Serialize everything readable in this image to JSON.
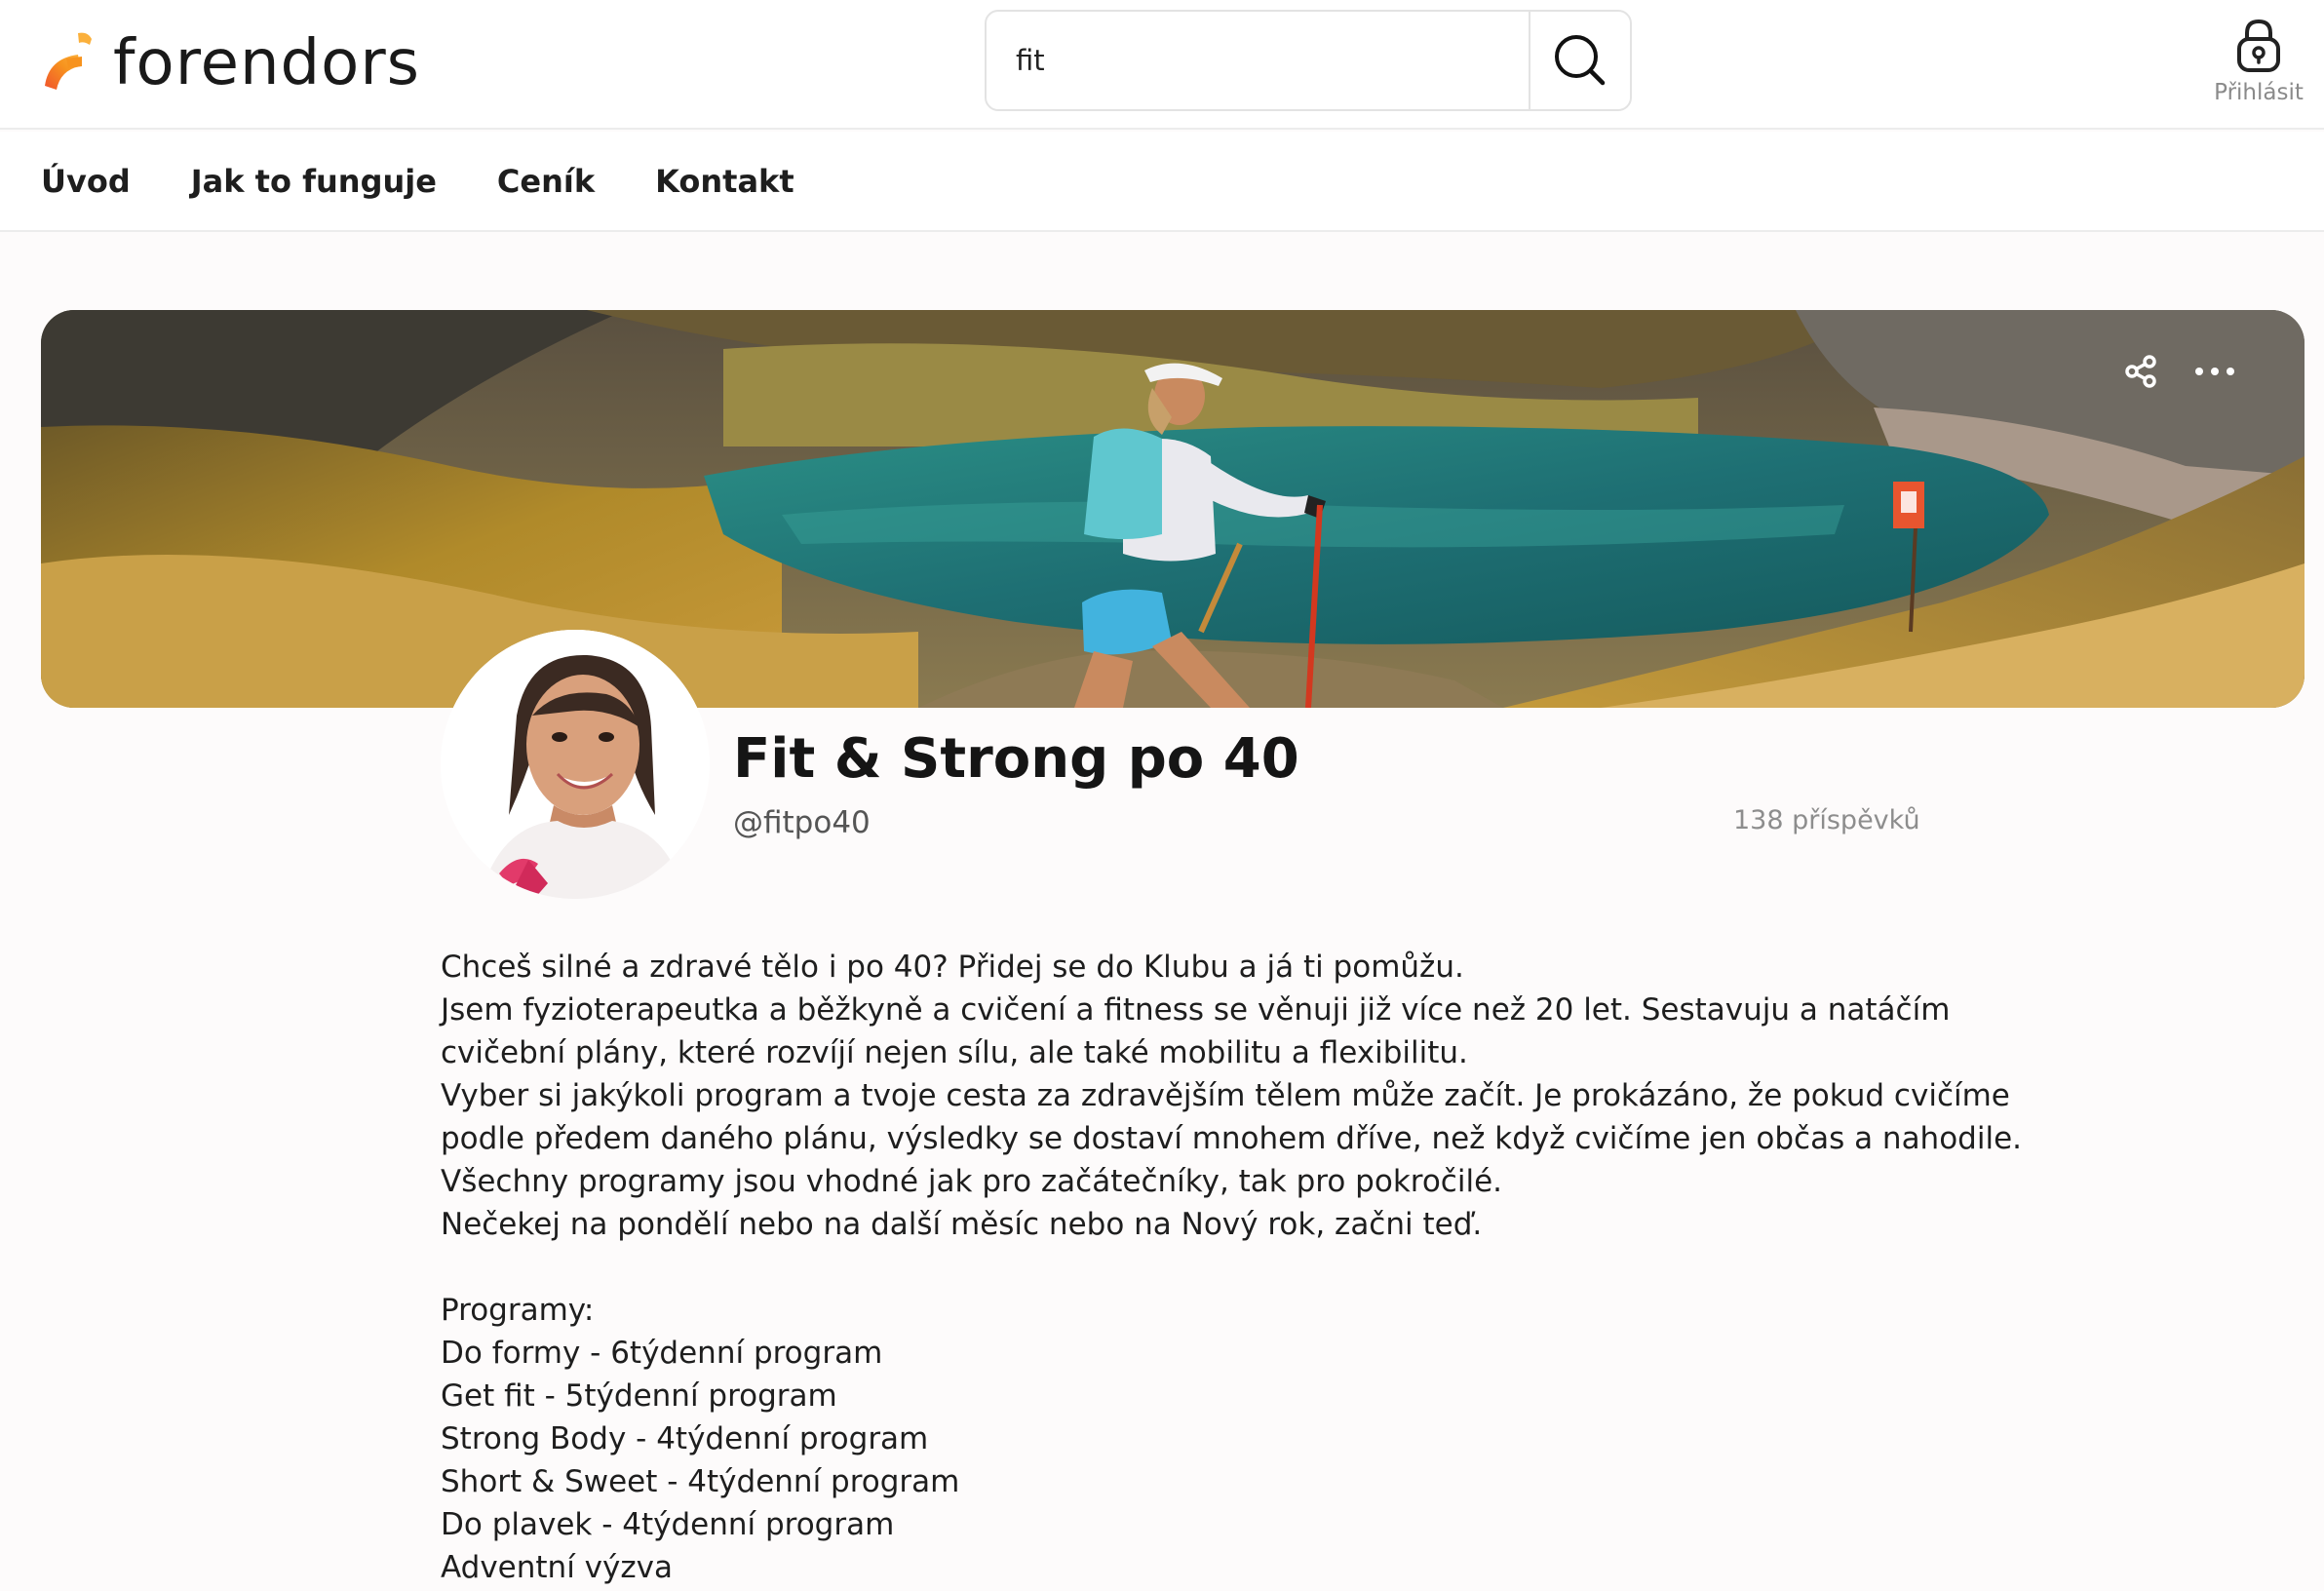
{
  "header": {
    "logo_text": "forendors",
    "search_value": "fit",
    "login_label": "Přihlásit"
  },
  "nav": {
    "items": [
      "Úvod",
      "Jak to funguje",
      "Ceník",
      "Kontakt"
    ]
  },
  "banner": {
    "share_icon": "share-icon",
    "more_icon": "more-options-icon"
  },
  "profile": {
    "name": "Fit & Strong po 40",
    "handle": "@fitpo40",
    "post_count": "138 příspěvků"
  },
  "bio": {
    "lines": [
      "Chceš silné a zdravé tělo i po 40? Přidej se do Klubu a já ti pomůžu.",
      "Jsem fyzioterapeutka a běžkyně a cvičení a fitness se věnuji již více než 20 let. Sestavuju a natáčím",
      "cvičební plány, které rozvíjí nejen sílu, ale také mobilitu a flexibilitu.",
      "Vyber si jakýkoli program a tvoje cesta za zdravějším tělem může začít. Je prokázáno, že pokud cvičíme",
      "podle předem daného plánu, výsledky se dostaví mnohem dříve, než když cvičíme jen občas a nahodile.",
      "Všechny programy jsou vhodné jak pro začátečníky, tak pro pokročilé.",
      "Nečekej na pondělí nebo na další měsíc nebo na Nový rok, začni teď."
    ],
    "programs_heading": "Programy:",
    "programs": [
      "Do formy - 6týdenní program",
      "Get fit - 5týdenní program",
      "Strong Body - 4týdenní program",
      "Short & Sweet - 4týdenní program",
      "Do plavek - 4týdenní program",
      "Adventní výzva"
    ]
  },
  "colors": {
    "logo_orange": "#f7931e",
    "logo_red": "#f0532d",
    "logo_yellow": "#fbb03b"
  }
}
